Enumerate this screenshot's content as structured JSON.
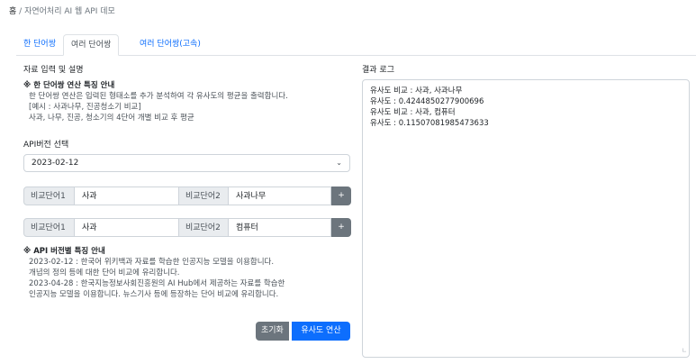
{
  "breadcrumb": {
    "home": "홈",
    "separator": "/",
    "current": "자연어처리 AI 웹 API 데모"
  },
  "tabs": [
    {
      "label": "한 단어쌍",
      "active": false
    },
    {
      "label": "여러 단어쌍",
      "active": true
    },
    {
      "label": "여러 단어쌍(고속)",
      "active": false
    }
  ],
  "input_section": {
    "title": "자료 입력 및 설명",
    "notice_title": "※ 한 단어쌍 연산 특징 안내",
    "notice_lines": [
      "한 단어쌍 연산은 입력된 형태소를 추가 분석하여 각 유사도의 평균을 출력합니다.",
      "[예시 : 사과나무, 진공청소기 비교]",
      "사과, 나무, 진공, 청소기의 4단어 개별 비교 후 평균"
    ]
  },
  "api_version": {
    "label": "API버전 선택",
    "selected": "2023-02-12"
  },
  "pairs": [
    {
      "label1": "비교단어1",
      "value1": "사과",
      "label2": "비교단어2",
      "value2": "사과나무",
      "button": "+"
    },
    {
      "label1": "비교단어1",
      "value1": "사과",
      "label2": "비교단어2",
      "value2": "컴퓨터",
      "button": "+"
    }
  ],
  "api_notice": {
    "title": "※ API 버전별 특징 안내",
    "lines": [
      "2023-02-12 : 한국어 위키백과 자료를 학습한 인공지능 모델을 이용합니다.",
      "개념의 정의 등에 대한 단어 비교에 유리합니다.",
      "2023-04-28 : 한국지능정보사회진흥원의 AI Hub에서 제공하는 자료를 학습한",
      "인공지능 모델을 이용합니다. 뉴스기사 등에 등장하는 단어 비교에 유리합니다."
    ]
  },
  "buttons": {
    "reset": "초기화",
    "calculate": "유사도 연산"
  },
  "result": {
    "label": "결과 로그",
    "lines": [
      "유사도 비교 : 사과, 사과나무",
      "유사도 : 0.4244850277900696",
      "유사도 비교 : 사과, 컴퓨터",
      "유사도 : 0.11507081985473633"
    ]
  },
  "icons": {
    "dropdown": "chevron-down-icon",
    "resize": "resize-handle-icon"
  },
  "colors": {
    "primary": "#0d6efd",
    "secondary": "#6c757d",
    "border": "#ced4da",
    "label_bg": "#e9ecef"
  }
}
